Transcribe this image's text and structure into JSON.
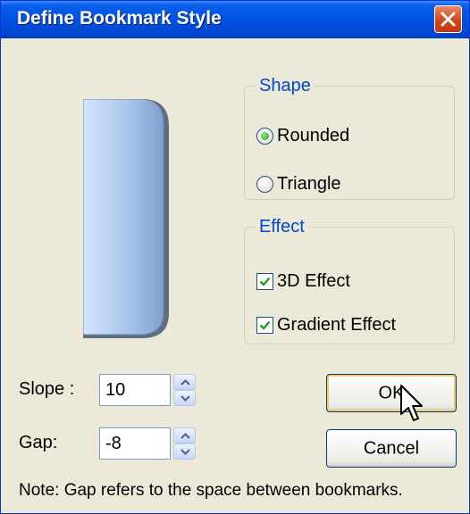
{
  "window": {
    "title": "Define Bookmark Style"
  },
  "shape_group": {
    "legend": "Shape",
    "options": [
      {
        "label": "Rounded",
        "selected": true
      },
      {
        "label": "Triangle",
        "selected": false
      }
    ]
  },
  "effect_group": {
    "legend": "Effect",
    "options": [
      {
        "label": "3D Effect",
        "checked": true
      },
      {
        "label": "Gradient Effect",
        "checked": true
      }
    ]
  },
  "slope": {
    "label": "Slope :",
    "value": "10"
  },
  "gap": {
    "label": "Gap:",
    "value": "-8"
  },
  "buttons": {
    "ok": "OK",
    "cancel": "Cancel"
  },
  "note": "Note: Gap refers to the space between bookmarks.",
  "icons": {
    "close": "close-icon",
    "cursor": "mouse-pointer-icon",
    "spin_up": "arrow-up-icon",
    "spin_down": "arrow-down-icon"
  },
  "colors": {
    "titlebar": "#0054e3",
    "close_button": "#d5441b",
    "group_legend": "#0046d5",
    "dialog_bg": "#ece9d8"
  }
}
